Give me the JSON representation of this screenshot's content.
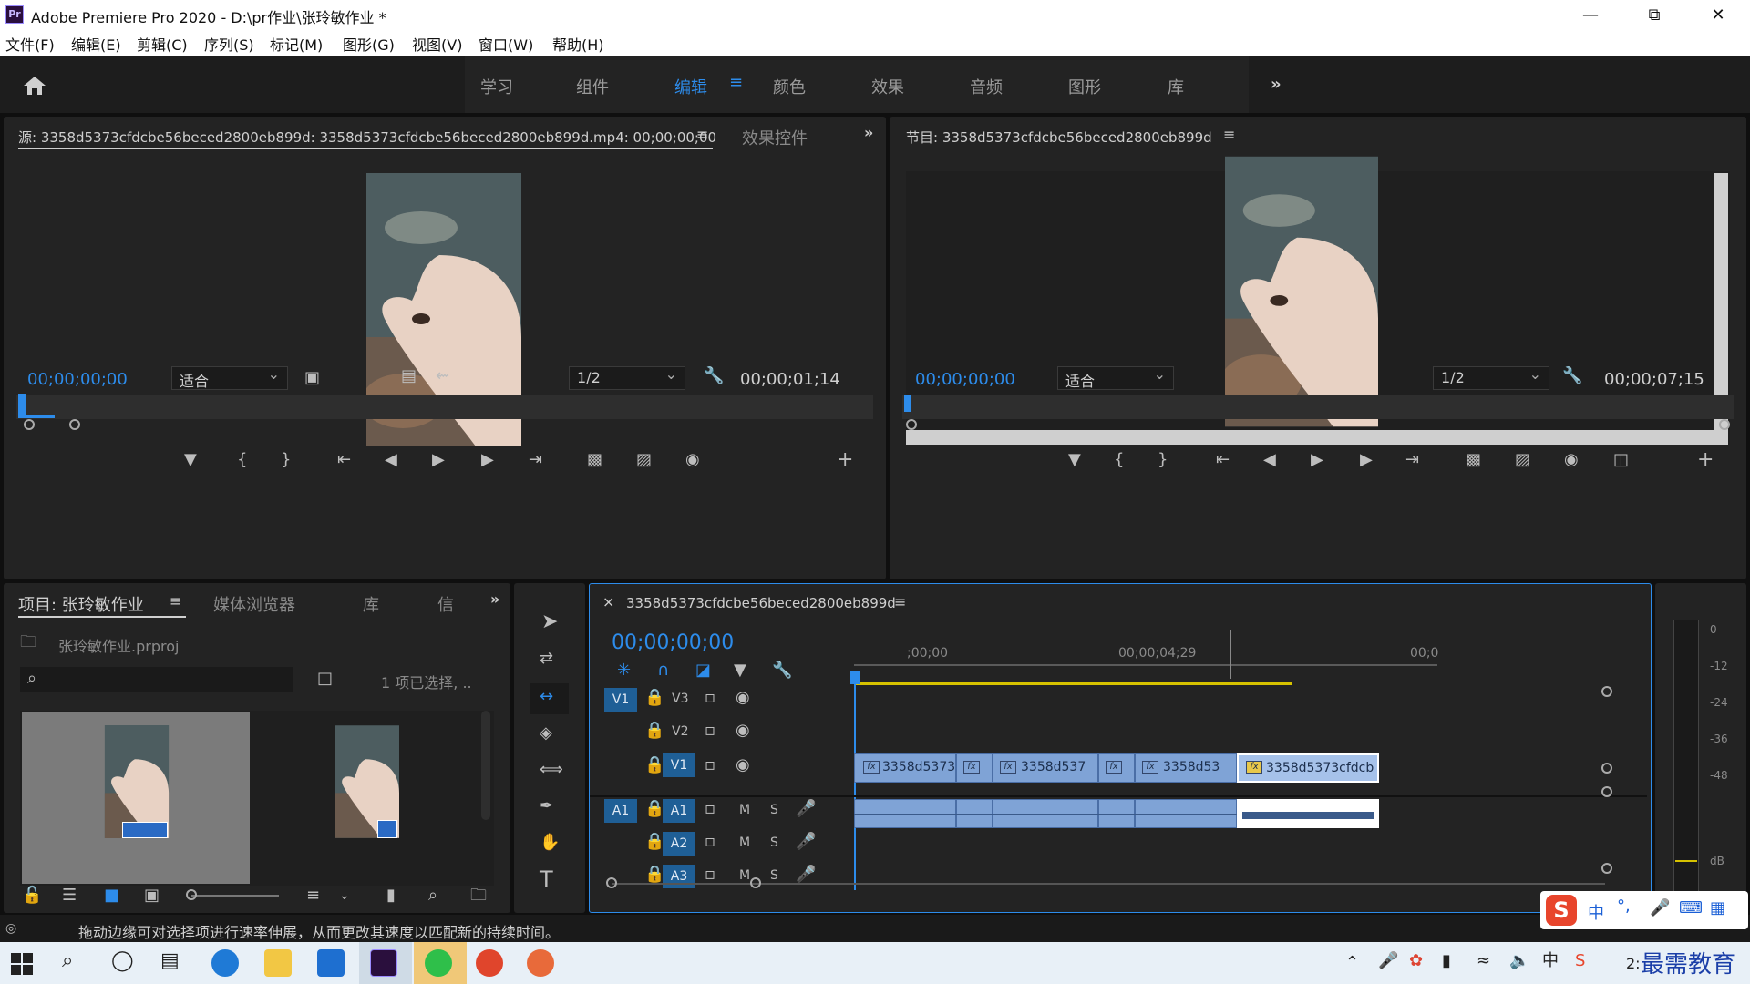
{
  "app": {
    "logo_text": "Pr",
    "title": "Adobe Premiere Pro 2020 - D:\\pr作业\\张玲敏作业 *",
    "window_buttons": [
      "minimize-icon",
      "restore-icon",
      "close-icon"
    ]
  },
  "menu": [
    "文件(F)",
    "编辑(E)",
    "剪辑(C)",
    "序列(S)",
    "标记(M)",
    "图形(G)",
    "视图(V)",
    "窗口(W)",
    "帮助(H)"
  ],
  "workspaces": {
    "items": [
      "学习",
      "组件",
      "编辑",
      "颜色",
      "效果",
      "音频",
      "图形",
      "库"
    ],
    "active": "编辑",
    "more": "»"
  },
  "source_monitor": {
    "tab_title": "源: 3358d5373cfdcbe56beced2800eb899d: 3358d5373cfdcbe56beced2800eb899d.mp4: 00;00;00;00",
    "tab2": "效果控件",
    "more": "»",
    "timecode_in": "00;00;00;00",
    "fit": "适合",
    "resolution": "1/2",
    "duration": "00;00;01;14"
  },
  "program_monitor": {
    "tab_title": "节目: 3358d5373cfdcbe56beced2800eb899d",
    "timecode_in": "00;00;00;00",
    "fit": "适合",
    "resolution": "1/2",
    "duration": "00;00;07;15"
  },
  "project_panel": {
    "tabs": [
      "项目: 张玲敏作业",
      "媒体浏览器",
      "库",
      "信"
    ],
    "more": "»",
    "project_file": "张玲敏作业.prproj",
    "selection_status": "1 项已选择, ..",
    "search_placeholder": ""
  },
  "timeline": {
    "sequence_name": "3358d5373cfdcbe56beced2800eb899d",
    "timecode": "00;00;00;00",
    "ruler_labels": [
      ";00;00",
      "00;00;04;29",
      "00;0"
    ],
    "video_tracks": [
      {
        "src": "V1",
        "name": "V3"
      },
      {
        "src": "",
        "name": "V2"
      },
      {
        "src": "",
        "name": "V1"
      }
    ],
    "audio_tracks": [
      {
        "src": "A1",
        "name": "A1"
      },
      {
        "src": "",
        "name": "A2"
      },
      {
        "src": "",
        "name": "A3"
      }
    ],
    "mute_label": "M",
    "solo_label": "S",
    "fx_label": "fx",
    "clips": [
      "3358d5373",
      "",
      "3358d537",
      "",
      "3358d53",
      "3358d5373cfdcb"
    ]
  },
  "audio_meter": {
    "ticks": [
      "0",
      "-12",
      "-24",
      "-36",
      "-48",
      "dB"
    ]
  },
  "statusbar": {
    "message": "拖动边缘可对选择项进行速率伸展，从而更改其速度以匹配新的持续时间。"
  },
  "ime": {
    "logo": "S",
    "items": [
      "中",
      "°,"
    ]
  },
  "taskbar": {
    "clock": "2:",
    "watermark": "最需教育"
  },
  "colors": {
    "accent": "#2d8ceb",
    "clip_video": "#7fa3d6",
    "clip_selected": "#a6c2ea",
    "playhead": "#2d8ceb",
    "work_area": "#d6c200"
  }
}
